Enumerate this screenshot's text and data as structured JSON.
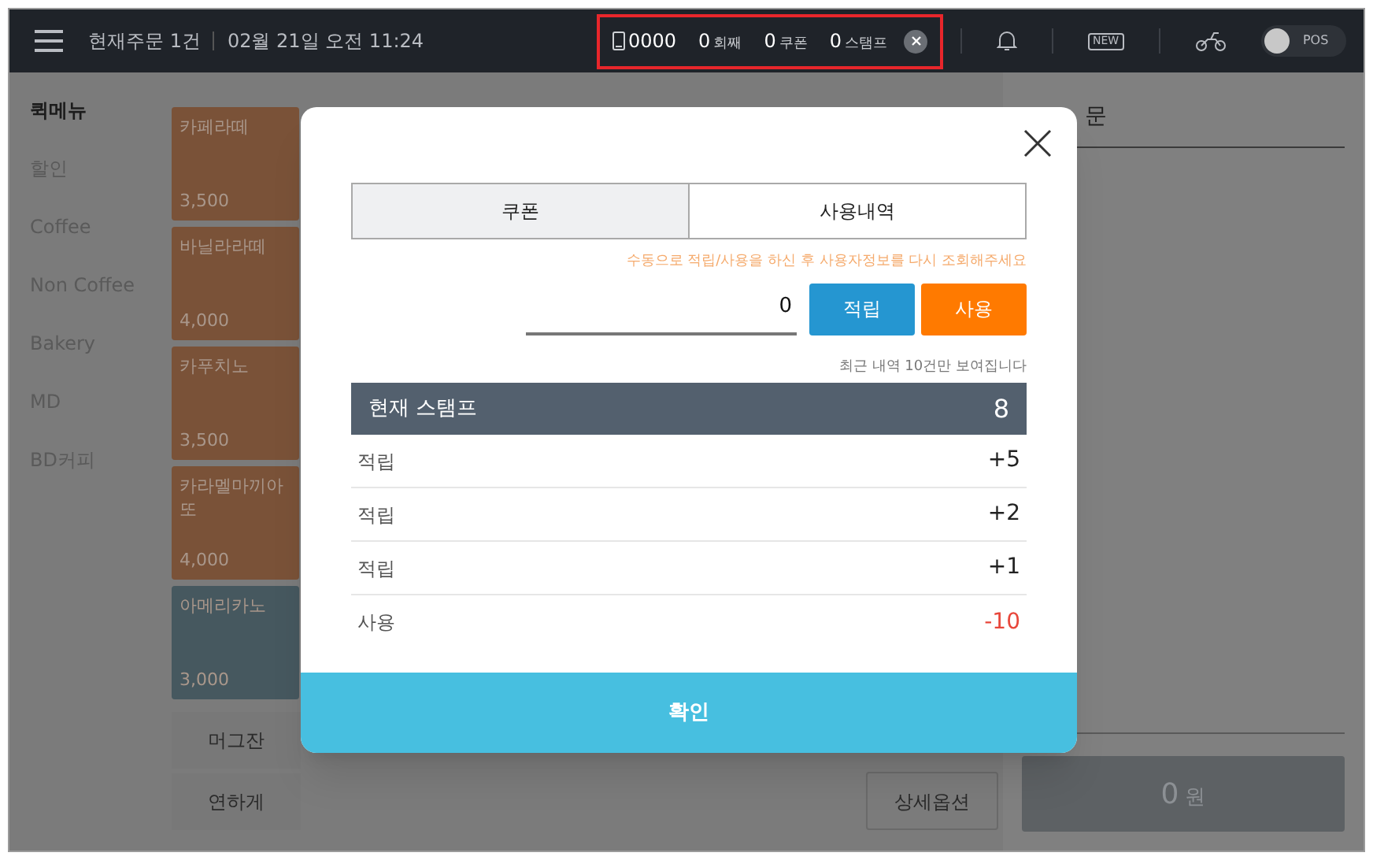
{
  "header": {
    "order_count": "현재주문 1건",
    "datetime": "02월 21일 오전 11:24",
    "member": {
      "phone": "0000",
      "counters": [
        {
          "value": "0",
          "unit": "회째"
        },
        {
          "value": "0",
          "unit": "쿠폰"
        },
        {
          "value": "0",
          "unit": "스탬프"
        }
      ]
    },
    "new_badge": "NEW",
    "pos_toggle": {
      "label": "POS",
      "on": false
    }
  },
  "categories": [
    {
      "label": "퀵메뉴",
      "selected": true
    },
    {
      "label": "할인",
      "selected": false
    },
    {
      "label": "Coffee",
      "selected": false
    },
    {
      "label": "Non Coffee",
      "selected": false
    },
    {
      "label": "Bakery",
      "selected": false
    },
    {
      "label": "MD",
      "selected": false
    },
    {
      "label": "BD커피",
      "selected": false
    }
  ],
  "menu_items": [
    {
      "name": "카페라떼",
      "price": "3,500",
      "color": "#7a5238"
    },
    {
      "name": "바닐라라떼",
      "price": "4,000",
      "color": "#7a5238"
    },
    {
      "name": "카푸치노",
      "price": "3,500",
      "color": "#7a5238"
    },
    {
      "name": "카라멜마끼아또",
      "price": "4,000",
      "color": "#7a5238"
    },
    {
      "name": "아메리카노",
      "price": "3,000",
      "color": "#46585f"
    }
  ],
  "options": [
    "머그잔",
    "연하게"
  ],
  "detail_button": "상세옵션",
  "order_panel": {
    "title": "문",
    "total": {
      "amount": "0",
      "unit": "원"
    }
  },
  "modal": {
    "tabs": [
      {
        "label": "쿠폰",
        "selected": true
      },
      {
        "label": "사용내역",
        "selected": false
      }
    ],
    "notice": "수동으로 적립/사용을 하신 후 사용자정보를 다시 조회해주세요",
    "input_value": "0",
    "earn_button": "적립",
    "use_button": "사용",
    "history_note": "최근 내역 10건만 보여집니다",
    "current": {
      "label": "현재 스탬프",
      "value": "8"
    },
    "history": [
      {
        "label": "적립",
        "value": "+5",
        "kind": "earn"
      },
      {
        "label": "적립",
        "value": "+2",
        "kind": "earn"
      },
      {
        "label": "적립",
        "value": "+1",
        "kind": "earn"
      },
      {
        "label": "사용",
        "value": "-10",
        "kind": "use"
      }
    ],
    "confirm_button": "확인"
  }
}
